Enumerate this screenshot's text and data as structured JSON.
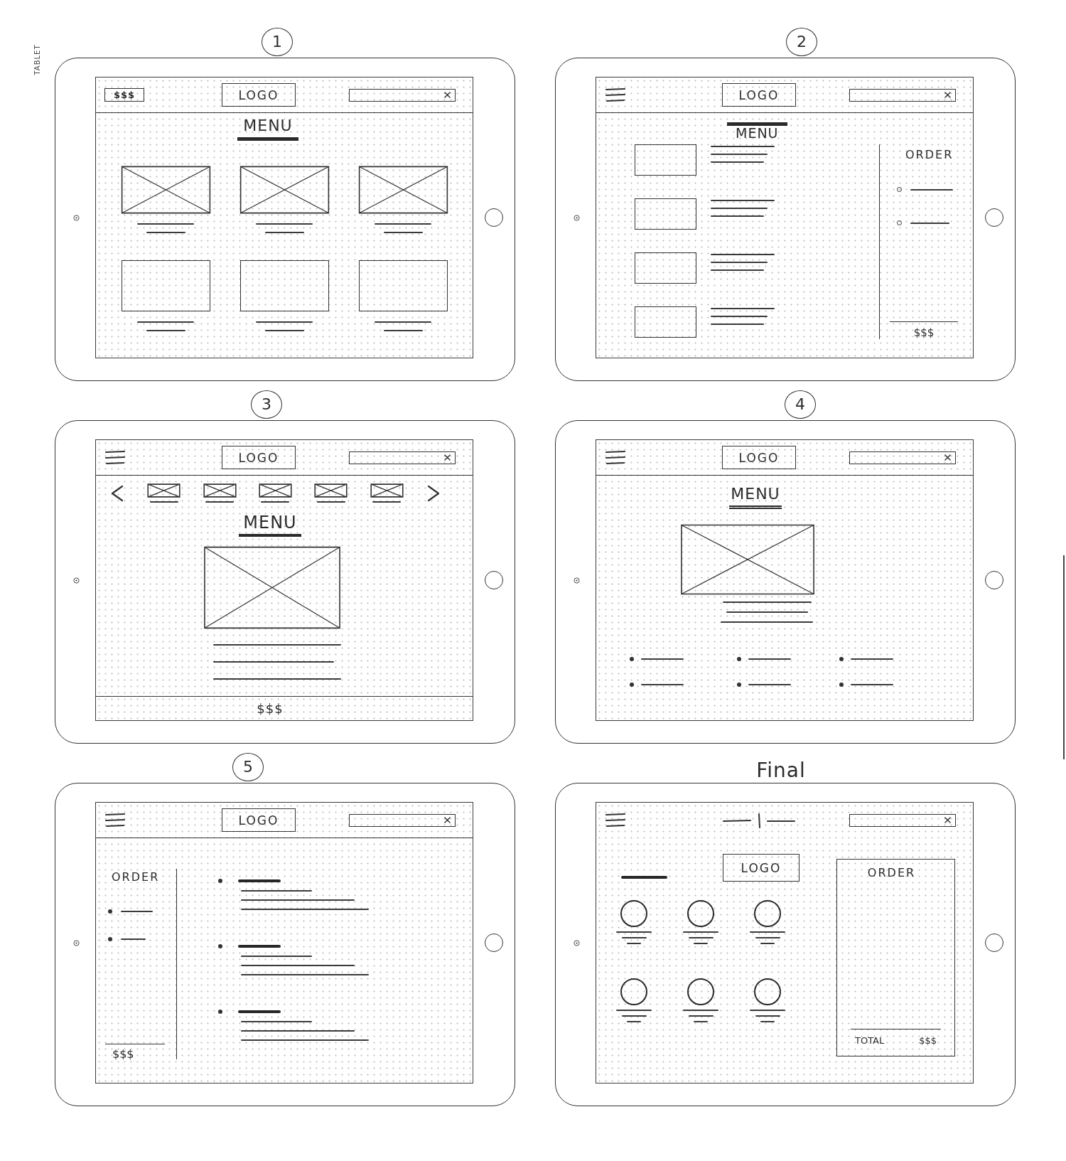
{
  "page_label": "TABLET",
  "sketches": [
    {
      "caption": "1",
      "circled": true,
      "kind": "grid",
      "header": {
        "left": {
          "kind": "price",
          "text": "$$$"
        },
        "center": {
          "kind": "logo",
          "text": "LOGO"
        }
      },
      "heading": "MENU",
      "cards": [
        {
          "kind": "image"
        },
        {
          "kind": "image"
        },
        {
          "kind": "image"
        },
        {
          "kind": "box"
        },
        {
          "kind": "box"
        },
        {
          "kind": "box"
        }
      ]
    },
    {
      "caption": "2",
      "circled": true,
      "kind": "list-order",
      "header": {
        "left": {
          "kind": "menu"
        },
        "center": {
          "kind": "logo",
          "text": "LOGO"
        }
      },
      "heading": "MENU",
      "order": {
        "title": "ORDER",
        "total": "$$$"
      }
    },
    {
      "caption": "3",
      "circled": true,
      "kind": "carousel",
      "header": {
        "left": {
          "kind": "menu"
        },
        "center": {
          "kind": "logo",
          "text": "LOGO"
        }
      },
      "heading": "MENU",
      "footer": "$$$"
    },
    {
      "caption": "4",
      "circled": true,
      "kind": "detail",
      "header": {
        "left": {
          "kind": "menu"
        },
        "center": {
          "kind": "logo",
          "text": "LOGO"
        }
      },
      "heading": "MENU"
    },
    {
      "caption": "5",
      "circled": true,
      "kind": "order-sidebar",
      "header": {
        "left": {
          "kind": "menu"
        },
        "center": {
          "kind": "logo",
          "text": "LOGO"
        }
      },
      "order": {
        "title": "ORDER",
        "total": "$$$"
      }
    },
    {
      "caption": "Final",
      "circled": false,
      "kind": "final",
      "header": {
        "left": {
          "kind": "menu"
        },
        "center": {
          "kind": "nav"
        }
      },
      "logo": "LOGO",
      "order": {
        "title": "ORDER",
        "total_label": "TOTAL",
        "total": "$$$"
      }
    }
  ]
}
